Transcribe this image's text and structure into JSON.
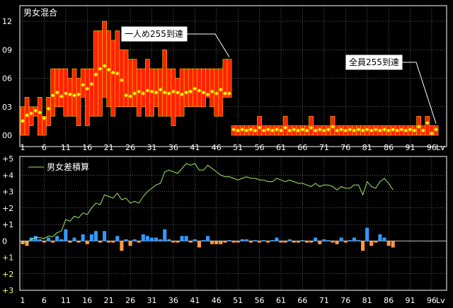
{
  "chart_data": [
    {
      "type": "bar",
      "title": "男女混合",
      "ylim": [
        0,
        12
      ],
      "y_ticks": [
        "00",
        "03",
        "06",
        "09",
        "12"
      ],
      "y_tick_values": [
        0,
        3,
        6,
        9,
        12
      ],
      "x_ticks": [
        "1",
        "6",
        "11",
        "16",
        "21",
        "26",
        "31",
        "36",
        "41",
        "46",
        "51",
        "56",
        "61",
        "66",
        "71",
        "76",
        "81",
        "86",
        "91",
        "96"
      ],
      "x_unit": "Lv",
      "x_max": 97,
      "grid": true,
      "bar_color": "#ff2200",
      "bar_edge_color": "#ffcc00",
      "avg_color": "#ffff00",
      "annotations": [
        {
          "text": "一人め255到達",
          "level": 49
        },
        {
          "text": "全員255到達",
          "level": 97
        }
      ],
      "series": [
        {
          "role": "max",
          "values": [
            3,
            4,
            3,
            3,
            4,
            2,
            4,
            7,
            7,
            7,
            7,
            6,
            7,
            6,
            7,
            7,
            7,
            11,
            11,
            12,
            11,
            10,
            11,
            9,
            9,
            8,
            8,
            7,
            7,
            8,
            7,
            7,
            7,
            9,
            7,
            7,
            6,
            7,
            7,
            7,
            7,
            7,
            7,
            7,
            7,
            7,
            7,
            8,
            8,
            1,
            1,
            1,
            1,
            1,
            1,
            2,
            1,
            1,
            1,
            1,
            1,
            2,
            1,
            1,
            1,
            1,
            1,
            2,
            1,
            1,
            1,
            1,
            2,
            1,
            1,
            1,
            1,
            1,
            1,
            1,
            1,
            1,
            1,
            1,
            1,
            1,
            1,
            1,
            1,
            1,
            1,
            1,
            2,
            1,
            2,
            1,
            1
          ]
        },
        {
          "role": "min",
          "values": [
            0,
            0,
            1,
            2,
            0,
            0,
            1,
            2,
            3,
            3,
            2,
            2,
            2,
            1,
            4,
            1,
            2,
            2,
            2,
            4,
            3,
            2,
            3,
            3,
            3,
            3,
            3,
            2,
            3,
            2,
            2,
            3,
            2,
            2,
            2,
            1,
            2,
            2,
            3,
            3,
            3,
            3,
            3,
            4,
            3,
            2,
            2,
            4,
            4,
            0,
            0,
            0,
            0,
            0,
            0,
            0,
            0,
            0,
            0,
            0,
            0,
            0,
            0,
            0,
            0,
            0,
            0,
            0,
            0,
            0,
            0,
            0,
            0,
            0,
            0,
            0,
            0,
            0,
            0,
            0,
            0,
            0,
            0,
            0,
            0,
            0,
            0,
            0,
            0,
            0,
            0,
            0,
            0,
            0,
            0,
            0,
            0
          ]
        },
        {
          "role": "average",
          "values": [
            1.5,
            2.1,
            2.3,
            2.6,
            2.4,
            1.8,
            2.8,
            4.2,
            4.5,
            4.1,
            4.4,
            4.3,
            4.2,
            4.3,
            5.3,
            4.9,
            5.4,
            6.4,
            7.0,
            7.3,
            6.9,
            6.6,
            6.5,
            5.8,
            4.2,
            4.1,
            4.4,
            4.6,
            4.4,
            4.7,
            4.6,
            4.5,
            4.8,
            4.5,
            4.4,
            4.6,
            4.5,
            4.3,
            4.5,
            4.6,
            4.9,
            4.7,
            4.5,
            4.3,
            4.6,
            4.4,
            4.8,
            4.4,
            4.4,
            0.6,
            0.5,
            0.6,
            0.5,
            0.6,
            0.5,
            0.8,
            0.5,
            0.6,
            0.5,
            0.6,
            0.5,
            0.8,
            0.5,
            0.6,
            0.5,
            0.6,
            0.5,
            0.8,
            0.5,
            0.6,
            0.5,
            0.6,
            0.9,
            0.5,
            0.6,
            0.5,
            0.6,
            0.5,
            0.6,
            0.5,
            0.6,
            0.5,
            0.6,
            0.5,
            0.6,
            0.5,
            0.6,
            0.5,
            0.6,
            0.5,
            0.6,
            0.5,
            0.9,
            0.5,
            1.3,
            0.2,
            0.6
          ]
        }
      ]
    },
    {
      "type": "bar",
      "title": "男女差積算",
      "ylim": [
        -3,
        5
      ],
      "y_ticks": [
        "+5",
        "+4",
        "+3",
        "+2",
        "+1",
        "0",
        "+1",
        "+2",
        "+3"
      ],
      "y_tick_values": [
        5,
        4,
        3,
        2,
        1,
        0,
        -1,
        -2,
        -3
      ],
      "x_ticks": [
        "1",
        "6",
        "11",
        "16",
        "21",
        "26",
        "31",
        "36",
        "41",
        "46",
        "51",
        "56",
        "61",
        "66",
        "71",
        "76",
        "81",
        "86",
        "91",
        "96"
      ],
      "x_unit": "Lv",
      "x_max": 97,
      "grid": true,
      "legend": "top-left",
      "positive_color": "#3399ff",
      "negative_color": "#ff9944",
      "line_color": "#99ee66",
      "series": [
        {
          "name": "男女差積算",
          "role": "cumulative-line",
          "values": [
            -0.05,
            -0.1,
            0.1,
            0.2,
            0.2,
            0.15,
            0.3,
            0.25,
            0.5,
            0.6,
            1.3,
            1.2,
            1.5,
            1.4,
            1.7,
            1.6,
            2.0,
            2.3,
            2.2,
            2.8,
            2.7,
            2.6,
            2.9,
            2.5,
            2.6,
            2.3,
            2.4,
            2.3,
            2.7,
            3.0,
            3.2,
            3.4,
            3.5,
            4.2,
            4.3,
            4.2,
            4.1,
            4.4,
            4.7,
            4.6,
            4.7,
            4.3,
            4.3,
            4.6,
            4.4,
            4.2,
            4.0,
            3.9,
            3.9,
            3.8,
            3.7,
            3.8,
            3.9,
            3.8,
            3.8,
            3.7,
            3.7,
            3.6,
            3.6,
            3.8,
            3.7,
            3.6,
            3.7,
            3.6,
            3.5,
            3.5,
            3.4,
            3.3,
            3.5,
            3.3,
            3.4,
            3.4,
            3.3,
            3.1,
            3.3,
            3.2,
            3.2,
            3.4,
            3.4,
            2.8,
            3.6,
            3.3,
            3.2,
            3.6,
            3.8,
            3.5,
            3.1
          ]
        },
        {
          "role": "per-level-diff",
          "values": [
            -0.2,
            -0.3,
            0.2,
            0.3,
            0.1,
            -0.1,
            0.2,
            -0.1,
            0.3,
            0.1,
            0.7,
            -0.1,
            0.2,
            -0.1,
            0.4,
            -0.2,
            0.4,
            0.6,
            -0.1,
            0.6,
            -0.1,
            -0.1,
            0.3,
            -0.6,
            0.1,
            -0.3,
            0.1,
            -0.1,
            0.4,
            0.3,
            0.2,
            0.2,
            0.1,
            0.7,
            0.1,
            -0.1,
            -0.1,
            0.3,
            0.3,
            -0.1,
            0.1,
            -0.4,
            0.05,
            0.3,
            -0.2,
            -0.2,
            -0.2,
            -0.1,
            0.05,
            -0.1,
            -0.1,
            0.1,
            0.1,
            -0.1,
            0.05,
            -0.1,
            0.05,
            -0.1,
            0.05,
            0.2,
            -0.1,
            -0.1,
            0.1,
            -0.1,
            -0.1,
            0.05,
            -0.1,
            -0.1,
            0.2,
            -0.2,
            0.1,
            0.05,
            -0.1,
            -0.2,
            0.2,
            -0.1,
            0.05,
            0.2,
            0.05,
            -0.6,
            0.8,
            -0.3,
            -0.1,
            0.4,
            0.2,
            -0.3,
            -0.4
          ]
        }
      ]
    }
  ]
}
